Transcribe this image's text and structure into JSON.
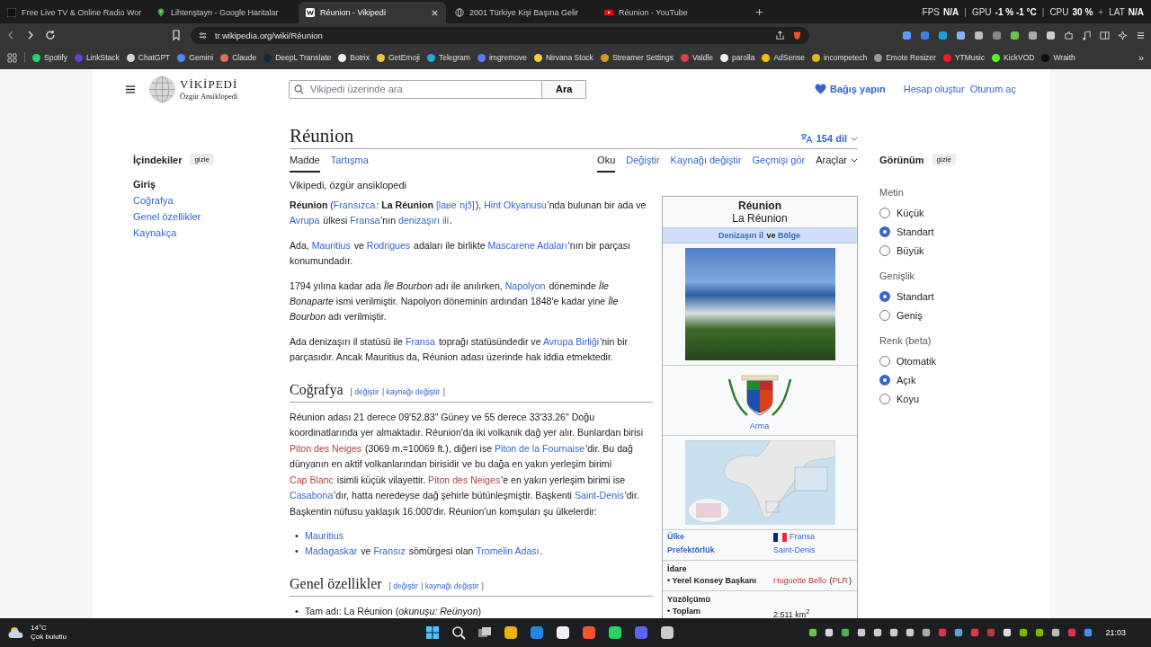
{
  "browser": {
    "tabs": [
      {
        "title": "Free Live TV & Online Radio Wor",
        "selected": false
      },
      {
        "title": "Lihtenştayn - Google Haritalar",
        "selected": false
      },
      {
        "title": "Réunion - Vikipedi",
        "selected": true
      },
      {
        "title": "2001 Türkiye Kişi Başına Gelir",
        "selected": false
      },
      {
        "title": "Réunion - YouTube",
        "selected": false
      }
    ],
    "stats": [
      {
        "label": "FPS",
        "value": "N/A",
        "sep": "|"
      },
      {
        "label": "GPU",
        "value": "-1 % -1 °C",
        "sep": "|"
      },
      {
        "label": "CPU",
        "value": "30 %",
        "sep": "+"
      },
      {
        "label": "LAT",
        "value": "N/A"
      }
    ],
    "url": "tr.wikipedia.org/wiki/Réunion",
    "bookmarks": [
      {
        "label": "Spotify",
        "color": "#1ed760"
      },
      {
        "label": "LinkStack",
        "color": "#6a3fd8"
      },
      {
        "label": "ChatGPT",
        "color": "#d8d8d8"
      },
      {
        "label": "Gemini",
        "color": "#4a8cf0"
      },
      {
        "label": "Claude",
        "color": "#d9734e"
      },
      {
        "label": "DeepL Translate",
        "color": "#0f2b46"
      },
      {
        "label": "Botrix",
        "color": "#eeeeee"
      },
      {
        "label": "GetEmoji",
        "color": "#f5c33b"
      },
      {
        "label": "Telegram",
        "color": "#2aa3e0"
      },
      {
        "label": "imgremove",
        "color": "#5b7cf0"
      },
      {
        "label": "Nirvana Stock",
        "color": "#f2d230"
      },
      {
        "label": "Streamer Settings",
        "color": "#d49a2a"
      },
      {
        "label": "Valdle",
        "color": "#e0404a"
      },
      {
        "label": "parolla",
        "color": "#f2f2f2"
      },
      {
        "label": "AdSense",
        "color": "#fbbc04"
      },
      {
        "label": "incompetech",
        "color": "#e8b820"
      },
      {
        "label": "Emote Resizer",
        "color": "#9a9a9a"
      },
      {
        "label": "YTMusic",
        "color": "#ff1a2a"
      },
      {
        "label": "KickVOD",
        "color": "#53fc18"
      },
      {
        "label": "Wraith",
        "color": "#101010"
      }
    ],
    "bookmarks_more": "»"
  },
  "wiki": {
    "logo_title": "VİKİPEDİ",
    "logo_subtitle": "Özgür Ansiklopedi",
    "search": {
      "placeholder": "Vikipedi üzerinde ara",
      "button": "Ara"
    },
    "donate": "Bağış yapın",
    "user_links": [
      "Hesap oluştur",
      "Oturum aç"
    ],
    "toc": {
      "title": "İçindekiler",
      "hide": "gizle",
      "items": [
        {
          "label": "Giriş",
          "selected": true
        },
        {
          "label": "Coğrafya",
          "selected": false
        },
        {
          "label": "Genel özellikler",
          "selected": false
        },
        {
          "label": "Kaynakça",
          "selected": false
        }
      ]
    },
    "title": "Réunion",
    "languages": "154 dil",
    "namespace_tabs": [
      {
        "label": "Madde",
        "selected": true
      },
      {
        "label": "Tartışma",
        "selected": false
      }
    ],
    "view_tabs": [
      {
        "label": "Oku",
        "selected": true
      },
      {
        "label": "Değiştir",
        "selected": false
      },
      {
        "label": "Kaynağı değiştir",
        "selected": false
      },
      {
        "label": "Geçmişi gör",
        "selected": false
      }
    ],
    "tools": "Araçlar",
    "tagline": "Vikipedi, özgür ansiklopedi",
    "blocks": [
      {
        "kind": "p",
        "segs": [
          {
            "t": "Réunion",
            "kind": "bold"
          },
          {
            "t": " (",
            "kind": "text"
          },
          {
            "t": "Fransızca",
            "kind": "link"
          },
          {
            "t": ": ",
            "kind": "text"
          },
          {
            "t": "La Réunion ",
            "kind": "bold"
          },
          {
            "t": "[laʁe˙njɔ̃]",
            "kind": "link"
          },
          {
            "t": "), ",
            "kind": "text"
          },
          {
            "t": "Hint Okyanusu",
            "kind": "link"
          },
          {
            "t": "'nda bulunan bir ada ve ",
            "kind": "text"
          },
          {
            "t": "Avrupa",
            "kind": "link"
          },
          {
            "t": " ülkesi ",
            "kind": "text"
          },
          {
            "t": "Fransa",
            "kind": "link"
          },
          {
            "t": "'nın ",
            "kind": "text"
          },
          {
            "t": "denizaşırı ili",
            "kind": "link"
          },
          {
            "t": ".",
            "kind": "text"
          }
        ]
      },
      {
        "kind": "p",
        "segs": [
          {
            "t": "Ada, ",
            "kind": "text"
          },
          {
            "t": "Mauritius",
            "kind": "link"
          },
          {
            "t": " ve ",
            "kind": "text"
          },
          {
            "t": "Rodrigues",
            "kind": "link"
          },
          {
            "t": " adaları ile birlikte ",
            "kind": "text"
          },
          {
            "t": "Mascarene Adaları",
            "kind": "link"
          },
          {
            "t": "'nın bir parçası konumundadır.",
            "kind": "text"
          }
        ]
      },
      {
        "kind": "p",
        "segs": [
          {
            "t": "1794 yılına kadar ada ",
            "kind": "text"
          },
          {
            "t": "Île Bourbon",
            "kind": "italic"
          },
          {
            "t": " adı ile anılırken, ",
            "kind": "text"
          },
          {
            "t": "Napolyon",
            "kind": "link"
          },
          {
            "t": " döneminde ",
            "kind": "text"
          },
          {
            "t": "Île Bonaparte",
            "kind": "italic"
          },
          {
            "t": " ismi verilmiştir. Napolyon döneminin ardından 1848'e kadar yine ",
            "kind": "text"
          },
          {
            "t": "Île Bourbon",
            "kind": "italic"
          },
          {
            "t": " adı verilmiştir.",
            "kind": "text"
          }
        ]
      },
      {
        "kind": "p",
        "segs": [
          {
            "t": "Ada denizaşırı il statüsü ile ",
            "kind": "text"
          },
          {
            "t": "Fransa",
            "kind": "link"
          },
          {
            "t": " toprağı statüsündedir ve ",
            "kind": "text"
          },
          {
            "t": "Avrupa Birliği",
            "kind": "link"
          },
          {
            "t": "'nin bir parçasıdır. Ancak Mauritius da, Réunion adası üzerinde hak iddia etmektedir.",
            "kind": "text"
          }
        ]
      },
      {
        "kind": "h",
        "text": "Coğrafya",
        "segs": [
          {
            "t": "[ ",
            "kind": "text"
          },
          {
            "t": "değiştir",
            "kind": "link"
          },
          {
            "t": " | ",
            "kind": "text"
          },
          {
            "t": "kaynağı değiştir",
            "kind": "link"
          },
          {
            "t": " ]",
            "kind": "text"
          }
        ]
      },
      {
        "kind": "p",
        "segs": [
          {
            "t": "Réunion adası 21 derece 09'52.83\" Güney ve 55 derece 33'33.26\" Doğu koordinatlarında yer almaktadır. Réunion'da iki volkanik dağ yer alır. Bunlardan birisi ",
            "kind": "text"
          },
          {
            "t": "Piton des Neiges",
            "kind": "red"
          },
          {
            "t": " (3069 m.=10069 ft.), diğeri ise ",
            "kind": "text"
          },
          {
            "t": "Piton de la Fournaise",
            "kind": "link"
          },
          {
            "t": "'dir. Bu dağ dünyanın en aktif volkanlarından birisidir ve bu dağa en yakın yerleşim birimi ",
            "kind": "text"
          },
          {
            "t": "Cap Blanc",
            "kind": "red"
          },
          {
            "t": " isimli küçük vilayettir. ",
            "kind": "text"
          },
          {
            "t": "Piton des Neiges",
            "kind": "red"
          },
          {
            "t": "'e en yakın yerleşim birimi ise ",
            "kind": "text"
          },
          {
            "t": "Casabona",
            "kind": "link"
          },
          {
            "t": "'dır, hatta neredeyse dağ şehirle bütünleşmiştir. Başkenti ",
            "kind": "text"
          },
          {
            "t": "Saint-Denis",
            "kind": "link"
          },
          {
            "t": "'dir. Başkentin nüfusu yaklaşık 16.000'dir. Réunion'un komşuları şu ülkelerdir:",
            "kind": "text"
          }
        ]
      },
      {
        "kind": "ul",
        "marker": "•",
        "items": [
          [
            {
              "t": "Mauritius",
              "kind": "link"
            }
          ],
          [
            {
              "t": "Madagaskar",
              "kind": "link"
            },
            {
              "t": " ve ",
              "kind": "text"
            },
            {
              "t": "Fransız",
              "kind": "link"
            },
            {
              "t": " sömürgesi olan ",
              "kind": "text"
            },
            {
              "t": "Tromelin Adası",
              "kind": "link"
            },
            {
              "t": ".",
              "kind": "text"
            }
          ]
        ]
      },
      {
        "kind": "h",
        "text": "Genel özellikler",
        "segs": [
          {
            "t": "[ ",
            "kind": "text"
          },
          {
            "t": "değiştir",
            "kind": "link"
          },
          {
            "t": " | ",
            "kind": "text"
          },
          {
            "t": "kaynağı değiştir",
            "kind": "link"
          },
          {
            "t": " ]",
            "kind": "text"
          }
        ]
      },
      {
        "kind": "ul",
        "marker": "•",
        "items": [
          [
            {
              "t": "Tam adı: La Réunion (",
              "kind": "text"
            },
            {
              "t": "okunuşu: Reünyon",
              "kind": "italic"
            },
            {
              "t": ")",
              "kind": "text"
            }
          ]
        ]
      }
    ],
    "infobox": {
      "title": "Réunion",
      "subtitle": "La Réunion",
      "type_line": [
        {
          "t": "Denizaşırı il",
          "kind": "link"
        },
        {
          "t": " ve ",
          "kind": "bold"
        },
        {
          "t": "Bölge",
          "kind": "link"
        }
      ],
      "arms_caption": "Arma",
      "rows": [
        {
          "kind": "pair",
          "label": "Ülke",
          "link": true,
          "flag": true,
          "value": [
            {
              "t": "Fransa",
              "kind": "link"
            }
          ]
        },
        {
          "kind": "pair",
          "label": "Prefektörlük",
          "link": true,
          "flag": false,
          "value": [
            {
              "t": "Saint-Denis",
              "kind": "link"
            }
          ]
        },
        {
          "kind": "section",
          "label": "İdare"
        },
        {
          "kind": "pair",
          "label": "• Yerel Konsey Başkanı",
          "link": false,
          "flag": false,
          "value": [
            {
              "t": "Huguette Bello",
              "kind": "red"
            },
            {
              "t": " (",
              "kind": "text"
            },
            {
              "t": "PLR",
              "kind": "red"
            },
            {
              "t": ")",
              "kind": "text"
            }
          ]
        },
        {
          "kind": "section",
          "label": "Yüzölçümü"
        },
        {
          "kind": "pair",
          "label": "• Toplam",
          "link": false,
          "flag": false,
          "value": [
            {
              "t": "2.511 km$^{2}$",
              "kind": "rich"
            }
          ]
        }
      ]
    },
    "appearance": {
      "title": "Görünüm",
      "hide": "gizle",
      "groups": [
        {
          "title": "Metin",
          "options": [
            {
              "label": "Küçük",
              "selected": false
            },
            {
              "label": "Standart",
              "selected": true
            },
            {
              "label": "Büyük",
              "selected": false
            }
          ]
        },
        {
          "title": "Genişlik",
          "options": [
            {
              "label": "Standart",
              "selected": true
            },
            {
              "label": "Geniş",
              "selected": false
            }
          ]
        },
        {
          "title": "Renk (beta)",
          "options": [
            {
              "label": "Otomatik",
              "selected": false
            },
            {
              "label": "Açık",
              "selected": true
            },
            {
              "label": "Koyu",
              "selected": false
            }
          ]
        }
      ]
    }
  },
  "taskbar": {
    "temperature": "14°C",
    "weather": "Çok bulutlu",
    "time": "21:03"
  }
}
